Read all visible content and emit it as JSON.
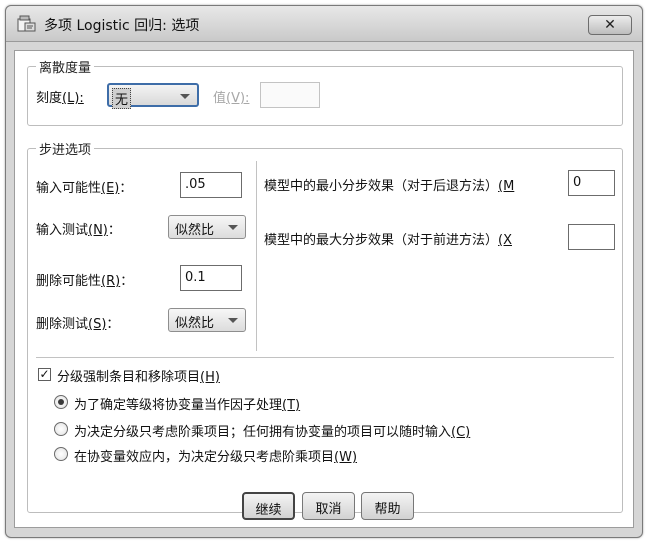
{
  "window": {
    "title": "多项 Logistic 回归: 选项",
    "close_symbol": "✕"
  },
  "dispersion": {
    "legend": "离散度量",
    "scale_label": "刻度",
    "scale_mnemonic": "(L):",
    "scale_value": "无",
    "value_label": "值",
    "value_mnemonic": "(V):",
    "value_input": ""
  },
  "stepping": {
    "legend": "步进选项",
    "entry_prob_label": "输入可能性",
    "entry_prob_mnemonic": "(E)",
    "entry_prob_colon": "：",
    "entry_prob_value": ".05",
    "entry_test_label": "输入测试",
    "entry_test_mnemonic": "(N)",
    "entry_test_colon": "：",
    "entry_test_value": "似然比",
    "removal_prob_label": "删除可能性",
    "removal_prob_mnemonic": "(R)",
    "removal_prob_colon": "：",
    "removal_prob_value": "0.1",
    "removal_test_label": "删除测试",
    "removal_test_mnemonic": "(S)",
    "removal_test_colon": "：",
    "removal_test_value": "似然比",
    "min_effects_label": "模型中的最小分步效果（对于后退方法）",
    "min_effects_mnemonic": "(M",
    "min_effects_value": "0",
    "max_effects_label": "模型中的最大分步效果（对于前进方法）",
    "max_effects_mnemonic": "(X",
    "max_effects_value": ""
  },
  "hierarchy": {
    "checkbox_label": "分级强制条目和移除项目",
    "checkbox_mnemonic": "(H)",
    "checked": true,
    "options": [
      {
        "label": "为了确定等级将协变量当作因子处理",
        "mnemonic": "(T)",
        "checked": true
      },
      {
        "label": "为决定分级只考虑阶乘项目；任何拥有协变量的项目可以随时输入",
        "mnemonic": "(C)",
        "checked": false
      },
      {
        "label": "在协变量效应内，为决定分级只考虑阶乘项目",
        "mnemonic": "(W)",
        "checked": false
      }
    ]
  },
  "buttons": {
    "continue": "继续",
    "cancel": "取消",
    "help": "帮助"
  }
}
